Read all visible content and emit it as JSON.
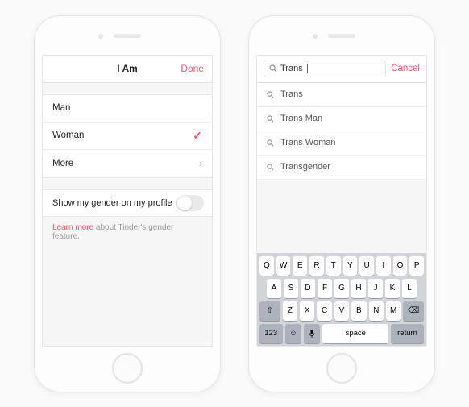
{
  "colors": {
    "accent": "#fd5068"
  },
  "left": {
    "header": {
      "title": "I Am",
      "done": "Done"
    },
    "options": [
      {
        "label": "Man",
        "selected": false
      },
      {
        "label": "Woman",
        "selected": true
      },
      {
        "label": "More",
        "chevron": true
      }
    ],
    "toggle": {
      "label": "Show my gender on my profile",
      "on": false
    },
    "footer": {
      "learn": "Learn more",
      "rest": " about Tinder's gender feature."
    }
  },
  "right": {
    "search": {
      "query": "Trans",
      "cancel": "Cancel"
    },
    "results": [
      "Trans",
      "Trans Man",
      "Trans Woman",
      "Transgender"
    ],
    "keyboard": {
      "row1": [
        "Q",
        "W",
        "E",
        "R",
        "T",
        "Y",
        "U",
        "I",
        "O",
        "P"
      ],
      "row2": [
        "A",
        "S",
        "D",
        "F",
        "G",
        "H",
        "J",
        "K",
        "L"
      ],
      "row3_shift": "⇧",
      "row3": [
        "Z",
        "X",
        "C",
        "V",
        "B",
        "N",
        "M"
      ],
      "row3_del": "⌫",
      "row4": {
        "k123": "123",
        "emoji": "☺",
        "mic": "🎤",
        "space": "space",
        "ret": "return"
      }
    }
  }
}
